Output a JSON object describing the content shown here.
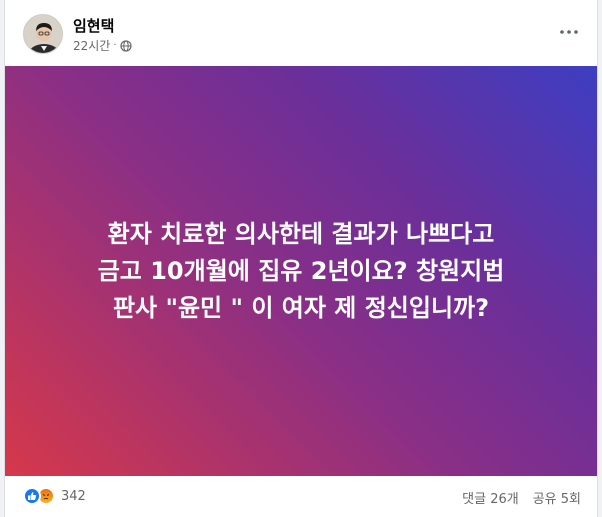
{
  "post": {
    "author": "임현택",
    "time": "22시간",
    "separator": "·",
    "lines": [
      "환자 치료한 의사한테 결과가 나쁘다고",
      "금고 10개월에 집유 2년이요? 창원지법",
      "판사 \"윤민 \" 이 여자 제 정신입니까?"
    ]
  },
  "footer": {
    "reaction_count": "342",
    "comments": "댓글 26개",
    "shares": "공유 5회"
  },
  "icons": {
    "privacy": "globe-icon",
    "more": "more-dots-icon",
    "reaction_1": "like-icon",
    "reaction_2": "angry-icon"
  },
  "colors": {
    "gradient_start": "#d6384a",
    "gradient_mid": "#8a2f86",
    "gradient_end": "#3d3ec2",
    "like": "#1877f2"
  }
}
